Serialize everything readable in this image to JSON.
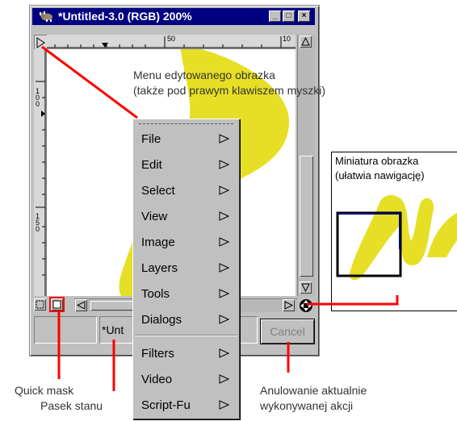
{
  "window": {
    "title": "*Untitled-3.0 (RGB) 200%",
    "buttons": {
      "minimize": "_",
      "maximize": "□",
      "close": "×"
    }
  },
  "rulers": {
    "horizontal_labels": [
      "50",
      "10"
    ],
    "vertical_labels": [
      "1\n0\n0",
      "1\n5\n0"
    ]
  },
  "status": {
    "title_text": "*Unt",
    "cancel_label": "Cancel"
  },
  "menu": {
    "items": [
      {
        "label": "File"
      },
      {
        "label": "Edit"
      },
      {
        "label": "Select"
      },
      {
        "label": "View"
      },
      {
        "label": "Image"
      },
      {
        "label": "Layers"
      },
      {
        "label": "Tools"
      },
      {
        "label": "Dialogs"
      },
      {
        "label": "Filters"
      },
      {
        "label": "Video"
      },
      {
        "label": "Script-Fu"
      }
    ]
  },
  "navigation": {
    "title_line1": "Miniatura obrazka",
    "title_line2": "(ułatwia nawigację)"
  },
  "annotations": {
    "menu_line1": "Menu edytowanego obrazka",
    "menu_line2": "(także pod prawym klawiszem myszki)",
    "quick_mask": "Quick mask",
    "status_bar": "Pasek stanu",
    "cancel_line1": "Anulowanie aktualnie",
    "cancel_line2": "wykonywanej akcji"
  },
  "colors": {
    "title_bg": "#000080",
    "highlight": "#ff0000",
    "shape": "#e8e020",
    "nav_rect": "#000080"
  }
}
